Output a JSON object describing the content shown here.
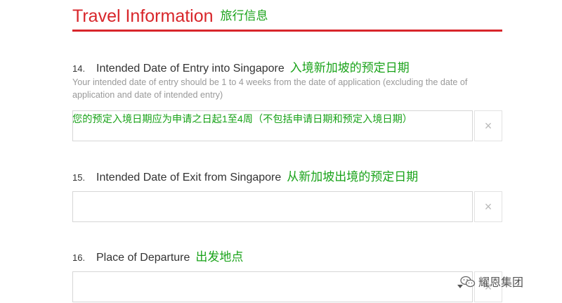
{
  "section": {
    "title": "Travel Information",
    "title_cn": "旅行信息",
    "accent_color": "#d8262b"
  },
  "questions": [
    {
      "number": "14.",
      "label": "Intended Date of Entry into Singapore",
      "label_cn": "入境新加坡的预定日期",
      "help": "Your intended date of entry should be 1 to 4 weeks from the date of application (excluding the date of application and date of intended entry)",
      "help_cn": "您的预定入境日期应为申请之日起1至4周（不包括申请日期和预定入境日期）",
      "value": "",
      "clear_label": "×"
    },
    {
      "number": "15.",
      "label": "Intended Date of Exit from Singapore",
      "label_cn": "从新加坡出境的预定日期",
      "value": "",
      "clear_label": "×"
    },
    {
      "number": "16.",
      "label": "Place of Departure",
      "label_cn": "出发地点",
      "value": "",
      "clear_label": "×"
    }
  ],
  "watermark": {
    "text": "耀恩集团",
    "icon": "wechat-icon"
  },
  "colors": {
    "annotation_green": "#1aa31a",
    "help_gray": "#999999",
    "border_gray": "#d6d6d6"
  }
}
